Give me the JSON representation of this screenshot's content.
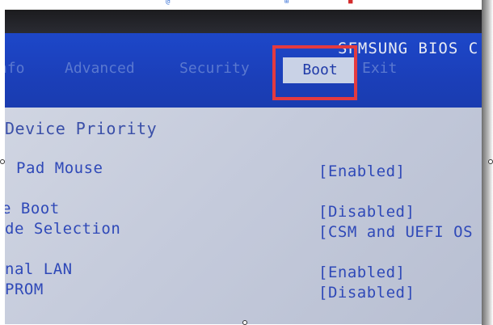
{
  "page_strip": {
    "glyphs": [
      "@",
      "⊞",
      "■"
    ]
  },
  "bios": {
    "brand": "SFMSUNG BIOS C",
    "tabs": [
      {
        "label": "nfo"
      },
      {
        "label": "Advanced"
      },
      {
        "label": "Security"
      },
      {
        "label": "Boot"
      },
      {
        "label": "Exit"
      }
    ],
    "active_tab": "Boot",
    "section_heading": "Device Priority",
    "settings": [
      {
        "label": "Pad Mouse",
        "value": "[Enabled]"
      },
      {
        "label": "e Boot",
        "value": "[Disabled]"
      },
      {
        "label": "de Selection",
        "value": "[CSM and UEFI OS"
      },
      {
        "label": "nal LAN",
        "value": "[Enabled]"
      },
      {
        "label": "PROM",
        "value": "[Disabled]"
      }
    ]
  },
  "colors": {
    "bios_blue": "#1d47c9",
    "text_blue": "#2f49b8",
    "highlight_red": "#e33a3f",
    "panel_grey": "#c4cadb"
  }
}
